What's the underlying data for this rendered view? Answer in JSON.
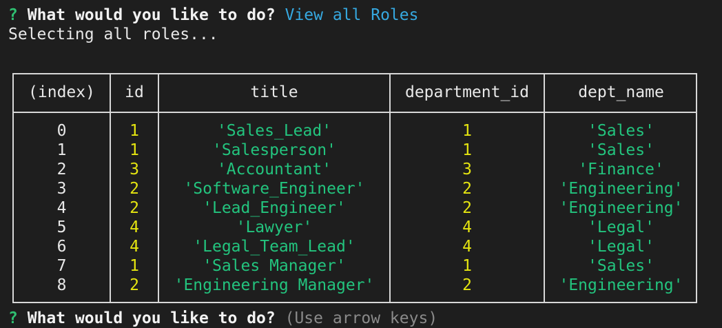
{
  "terminal": {
    "prompt": {
      "mark": "?",
      "question": "What would you like to do?",
      "answer": "View all Roles"
    },
    "status": "Selecting all roles...",
    "next_prompt": {
      "mark": "?",
      "question": "What would you like to do?",
      "hint": "(Use arrow keys)"
    }
  },
  "table": {
    "headers": [
      "(index)",
      "id",
      "title",
      "department_id",
      "dept_name"
    ],
    "rows": [
      {
        "index": "0",
        "id": "1",
        "title": "'Sales_Lead'",
        "department_id": "1",
        "dept_name": "'Sales'"
      },
      {
        "index": "1",
        "id": "1",
        "title": "'Salesperson'",
        "department_id": "1",
        "dept_name": "'Sales'"
      },
      {
        "index": "2",
        "id": "3",
        "title": "'Accountant'",
        "department_id": "3",
        "dept_name": "'Finance'"
      },
      {
        "index": "3",
        "id": "2",
        "title": "'Software_Engineer'",
        "department_id": "2",
        "dept_name": "'Engineering'"
      },
      {
        "index": "4",
        "id": "2",
        "title": "'Lead_Engineer'",
        "department_id": "2",
        "dept_name": "'Engineering'"
      },
      {
        "index": "5",
        "id": "4",
        "title": "'Lawyer'",
        "department_id": "4",
        "dept_name": "'Legal'"
      },
      {
        "index": "6",
        "id": "4",
        "title": "'Legal_Team_Lead'",
        "department_id": "4",
        "dept_name": "'Legal'"
      },
      {
        "index": "7",
        "id": "1",
        "title": "'Sales Manager'",
        "department_id": "1",
        "dept_name": "'Sales'"
      },
      {
        "index": "8",
        "id": "2",
        "title": "'Engineering Manager'",
        "department_id": "2",
        "dept_name": "'Engineering'"
      }
    ]
  },
  "colors": {
    "background": "#1e1e1e",
    "prompt_mark": "#2fbf71",
    "answer": "#36a9e1",
    "number": "#e5e510",
    "string": "#23c47e",
    "border": "#d8d8d8"
  }
}
